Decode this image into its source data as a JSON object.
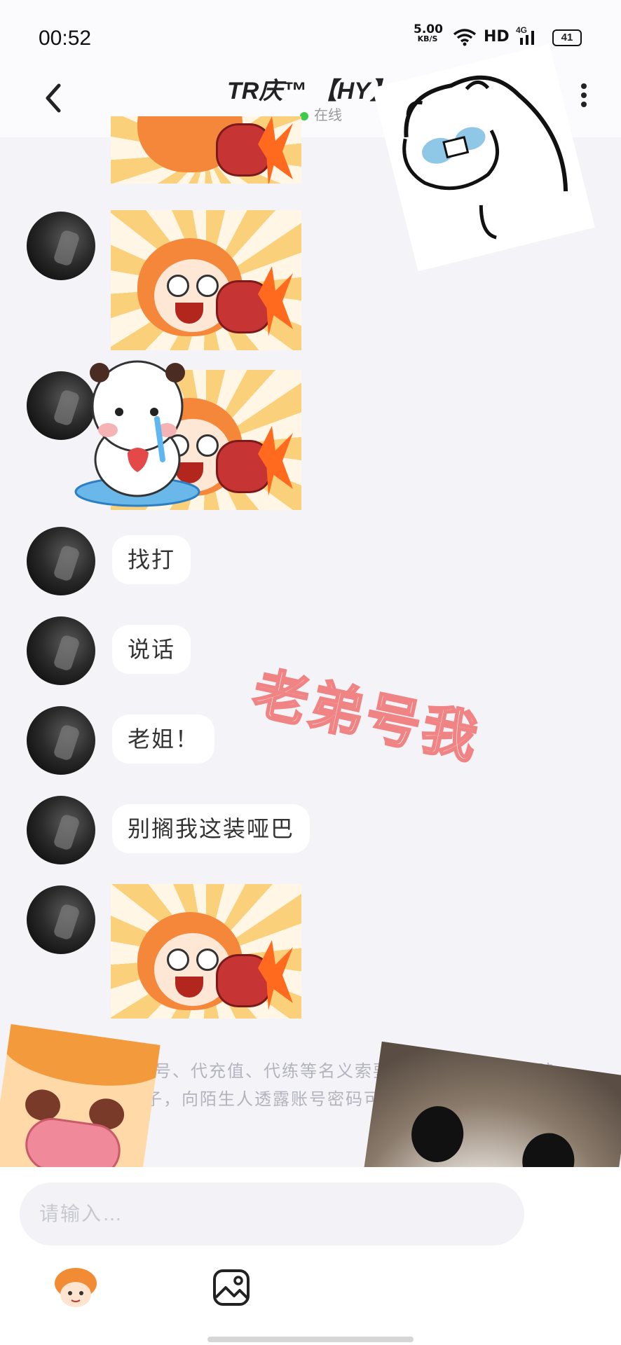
{
  "status_bar": {
    "time": "00:52",
    "net_speed_value": "5.00",
    "net_speed_unit": "KB/S",
    "hd_label": "HD",
    "signal_label": "4G",
    "battery": "41"
  },
  "header": {
    "title": "TR庆™ 【HY】",
    "status": "在线"
  },
  "messages": [
    {
      "type": "text",
      "text": "找打"
    },
    {
      "type": "text",
      "text": "说话"
    },
    {
      "type": "text",
      "text": "老姐！"
    },
    {
      "type": "text",
      "text": "别搁我这装哑巴"
    }
  ],
  "overlay_text": "老弟号我",
  "notice": "以买号、代充值、代练等名义索要账号和密码的都是骗子，向陌生人透露账号密码可能导致账号被盗。",
  "input": {
    "placeholder": "请输入…"
  },
  "icons": {
    "back": "chevron-left-icon",
    "more": "more-vertical-icon",
    "sticker": "sticker-icon",
    "image": "image-icon"
  }
}
